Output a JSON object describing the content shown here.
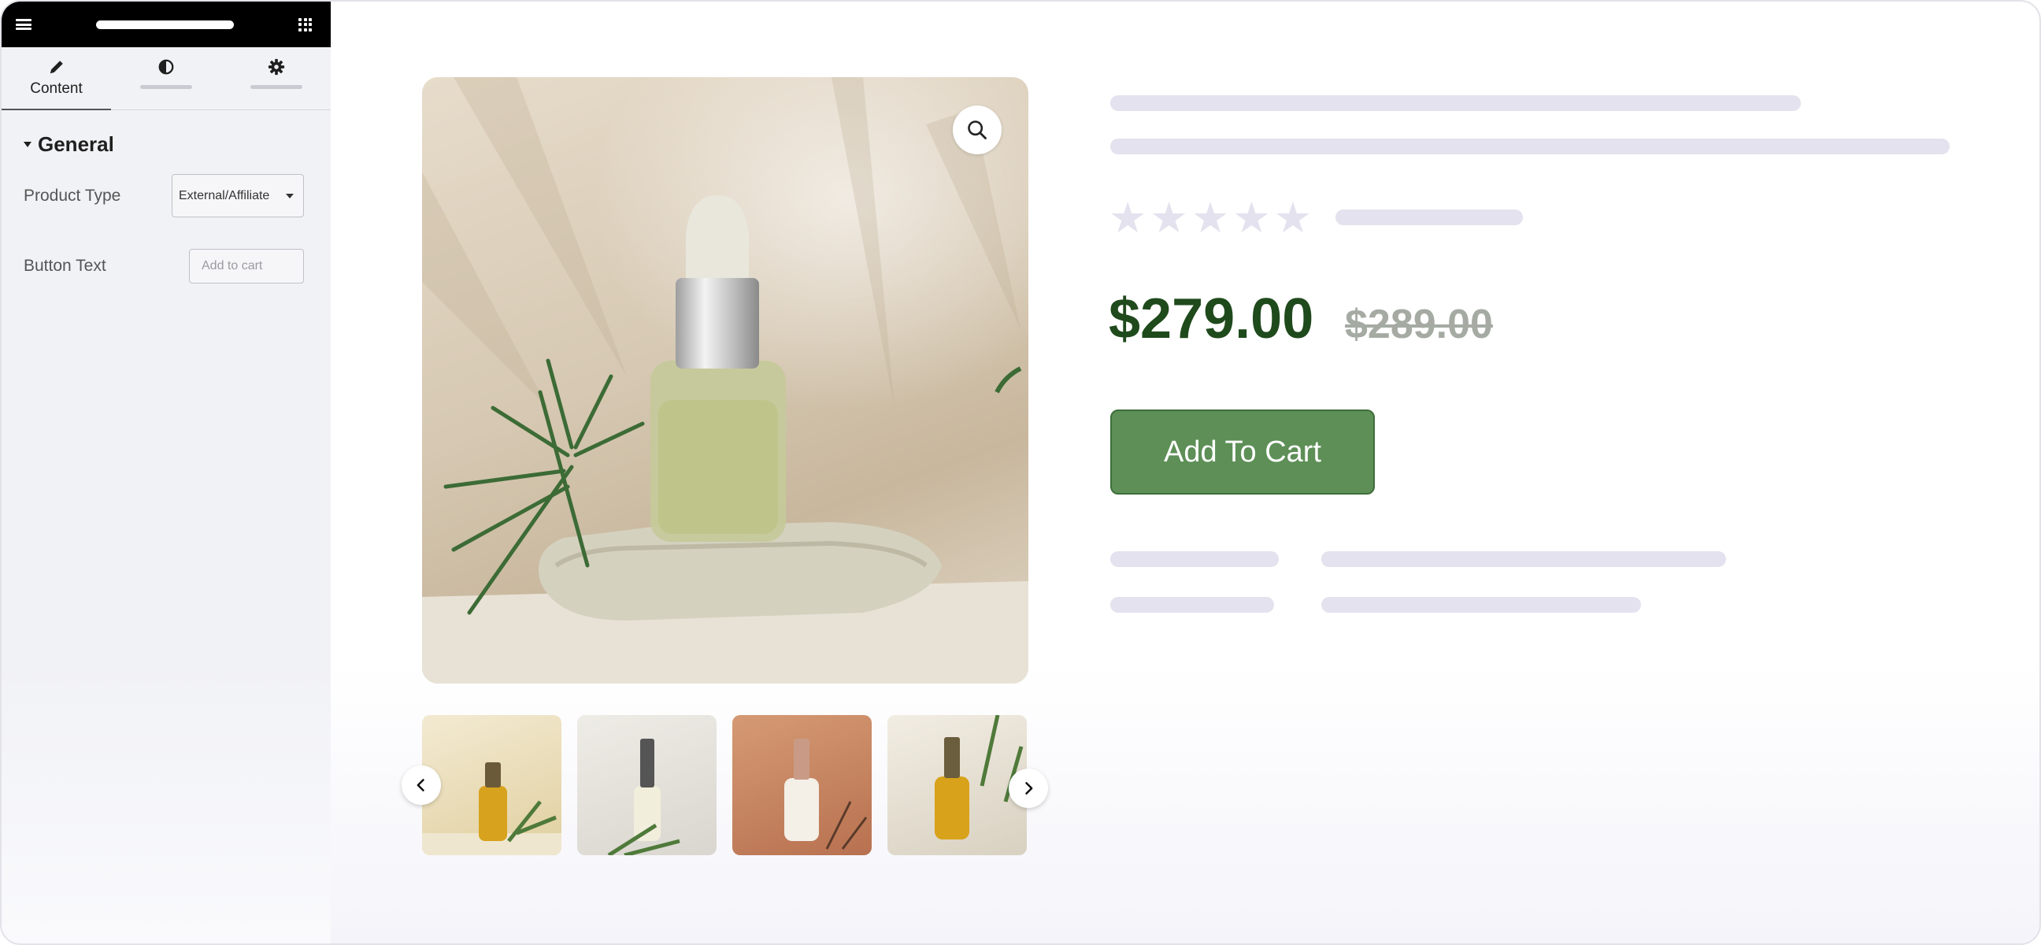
{
  "sidebar": {
    "tabs": [
      {
        "label": "Content",
        "icon": "pencil-icon",
        "active": true
      },
      {
        "label": "",
        "icon": "contrast-icon",
        "active": false
      },
      {
        "label": "",
        "icon": "gear-icon",
        "active": false
      }
    ],
    "section_title": "General",
    "fields": {
      "product_type": {
        "label": "Product Type",
        "value": "External/Affiliate"
      },
      "button_text": {
        "label": "Button Text",
        "placeholder": "Add to cart"
      }
    }
  },
  "product": {
    "price": "$279.00",
    "old_price": "$289.00",
    "rating_stars": 5,
    "cta_label": "Add To Cart"
  },
  "colors": {
    "price": "#1f4a1c",
    "cta_background": "#5d8f57",
    "skeleton": "#e3e2ee"
  }
}
